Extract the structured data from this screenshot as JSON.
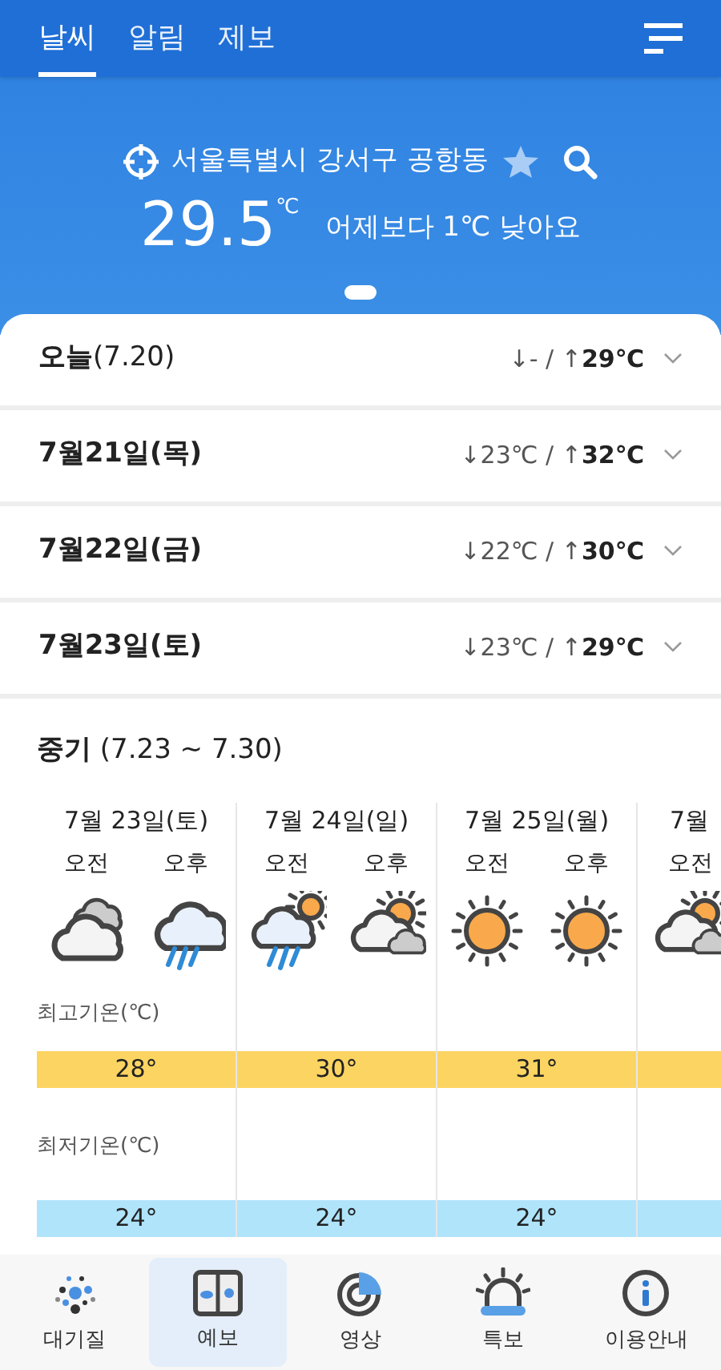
{
  "tabs": [
    {
      "label": "날씨",
      "selected": true
    },
    {
      "label": "알림",
      "selected": false
    },
    {
      "label": "제보",
      "selected": false
    }
  ],
  "location": {
    "name": "서울특별시 강서구 공항동",
    "favorite": false
  },
  "current": {
    "temp": "29.5",
    "unit": "℃",
    "compare": "어제보다 1℃ 낮아요"
  },
  "pager": [
    {
      "selected": true
    }
  ],
  "days": [
    {
      "date": "오늘",
      "sub": "(7.20)",
      "low": "↓-",
      "separator": "/",
      "high_arrow": "↑",
      "high": "29℃",
      "expanded": false
    },
    {
      "date": "7월21일(목)",
      "low": "↓23℃",
      "separator": "/",
      "high_arrow": "↑",
      "high": "32℃",
      "expanded": false
    },
    {
      "date": "7월22일(금)",
      "low": "↓22℃",
      "separator": "/",
      "high_arrow": "↑",
      "high": "30℃",
      "expanded": false
    },
    {
      "date": "7월23일(토)",
      "low": "↓23℃",
      "separator": "/",
      "high_arrow": "↑",
      "high": "29℃",
      "expanded": false
    }
  ],
  "midterm": {
    "title": "중기",
    "range": "(7.23 ~ 7.30)",
    "high_label": "최고기온(℃)",
    "low_label": "최저기온(℃)",
    "columns": [
      {
        "date": "7월 23일(토)",
        "periods": [
          {
            "label": "오전",
            "kind": "cloudy"
          },
          {
            "label": "오후",
            "kind": "rain"
          }
        ],
        "high": "28°",
        "low": "24°"
      },
      {
        "date": "7월 24일(일)",
        "periods": [
          {
            "label": "오전",
            "kind": "rain_sun"
          },
          {
            "label": "오후",
            "kind": "partly_cloudy"
          }
        ],
        "high": "30°",
        "low": "24°"
      },
      {
        "date": "7월 25일(월)",
        "periods": [
          {
            "label": "오전",
            "kind": "sunny"
          },
          {
            "label": "오후",
            "kind": "sunny"
          }
        ],
        "high": "31°",
        "low": "24°"
      },
      {
        "date": "7월",
        "periods": [
          {
            "label": "오전",
            "kind": "partly_cloudy"
          }
        ]
      }
    ]
  },
  "nav": [
    {
      "label": "대기질",
      "kind": "air",
      "selected": false
    },
    {
      "label": "예보",
      "kind": "forecast",
      "selected": true
    },
    {
      "label": "영상",
      "kind": "radar",
      "selected": false
    },
    {
      "label": "특보",
      "kind": "alert",
      "selected": false
    },
    {
      "label": "이용안내",
      "kind": "info",
      "selected": false
    }
  ]
}
